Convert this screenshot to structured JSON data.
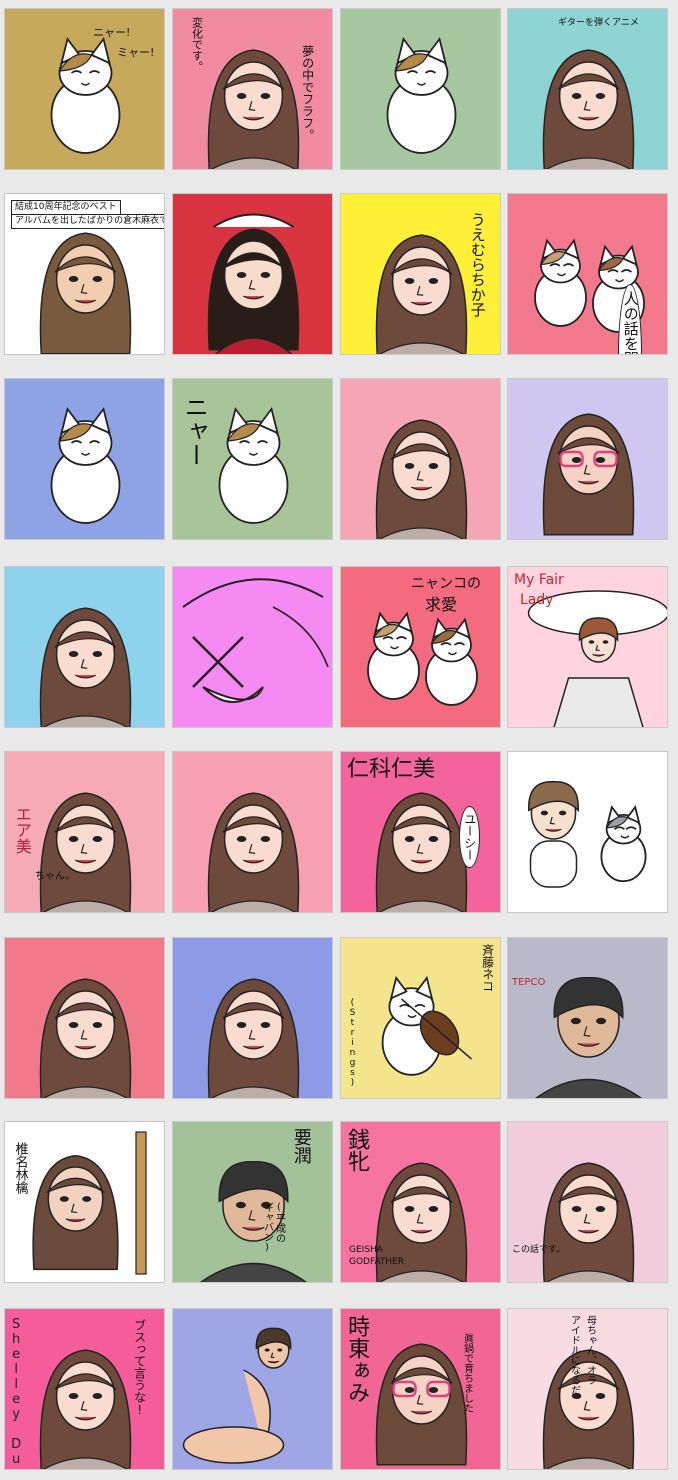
{
  "gallery": {
    "tiles": [
      {
        "bg": "#c7a95c",
        "subject": "cat",
        "texts": [
          "ニャー!",
          "ミャー!"
        ]
      },
      {
        "bg": "#f08ba0",
        "subject": "girl",
        "texts": [
          "変化です。",
          "夢の中でフラフ。"
        ]
      },
      {
        "bg": "#a7c7a0",
        "subject": "cat",
        "texts": []
      },
      {
        "bg": "#8fd4d4",
        "subject": "girl",
        "texts": [
          "ギターを弾くアニメ"
        ]
      },
      {
        "bg": "#ffffff",
        "subject": "person",
        "texts": [
          "結成10周年記念のベスト",
          "アルバムを出したばかりの倉木麻衣です。"
        ]
      },
      {
        "bg": "#d8343f",
        "subject": "maid",
        "texts": []
      },
      {
        "bg": "#ffef36",
        "subject": "woman",
        "texts": [
          "うえむらちか子"
        ]
      },
      {
        "bg": "#f27a8c",
        "subject": "cats",
        "texts": [
          "人の話を聞け!?"
        ]
      },
      {
        "bg": "#8fa2e6",
        "subject": "cat",
        "texts": []
      },
      {
        "bg": "#a8c59a",
        "subject": "cat",
        "texts": [
          "ニャー"
        ]
      },
      {
        "bg": "#f6a5b4",
        "subject": "woman",
        "texts": []
      },
      {
        "bg": "#cfc6f2",
        "subject": "woman-glasses",
        "texts": []
      },
      {
        "bg": "#8fd2ee",
        "subject": "girl",
        "texts": []
      },
      {
        "bg": "#f58af3",
        "subject": "abstract",
        "texts": []
      },
      {
        "bg": "#f46a7f",
        "subject": "cats",
        "texts": [
          "ニャンコの",
          "求愛"
        ]
      },
      {
        "bg": "#ffd3df",
        "subject": "lady",
        "texts": [
          "My Fair",
          "Lady"
        ]
      },
      {
        "bg": "#f6aab5",
        "subject": "girl",
        "texts": [
          "エア美",
          "ちゃん。"
        ]
      },
      {
        "bg": "#f7a0b2",
        "subject": "woman",
        "texts": []
      },
      {
        "bg": "#f3649c",
        "subject": "woman",
        "texts": [
          "仁科仁美",
          "ユーシー"
        ]
      },
      {
        "bg": "#ffffff",
        "subject": "baby-cat",
        "texts": []
      },
      {
        "bg": "#f07a8a",
        "subject": "girl",
        "texts": []
      },
      {
        "bg": "#8d9be6",
        "subject": "woman",
        "texts": []
      },
      {
        "bg": "#f4e48b",
        "subject": "cat-violin",
        "texts": [
          "斉藤ネコ",
          "(Strings)"
        ]
      },
      {
        "bg": "#b9b9c9",
        "subject": "man",
        "texts": [
          "TEPCO"
        ]
      },
      {
        "bg": "#ffffff",
        "subject": "woman-guitar",
        "texts": [
          "椎名林檎"
        ]
      },
      {
        "bg": "#a3c29a",
        "subject": "man",
        "texts": [
          "要潤",
          "(平成の",
          "ギャバン)"
        ]
      },
      {
        "bg": "#f574a0",
        "subject": "woman",
        "texts": [
          "銭牝",
          "GEISHA",
          "GODFATHER"
        ]
      },
      {
        "bg": "#f2cbdc",
        "subject": "woman",
        "texts": [
          "この話です。"
        ]
      },
      {
        "bg": "#f55c9a",
        "subject": "woman",
        "texts": [
          "Shelley Duvall",
          "ブスって言うな!"
        ]
      },
      {
        "bg": "#9ea6e6",
        "subject": "couple",
        "texts": []
      },
      {
        "bg": "#f26696",
        "subject": "woman-glasses",
        "texts": [
          "時東ぁみ",
          "眞鍋で育ちました"
        ]
      },
      {
        "bg": "#f8dbe3",
        "subject": "woman",
        "texts": [
          "母ちゃん、オラ",
          "アイドルになるだ。"
        ]
      }
    ]
  }
}
